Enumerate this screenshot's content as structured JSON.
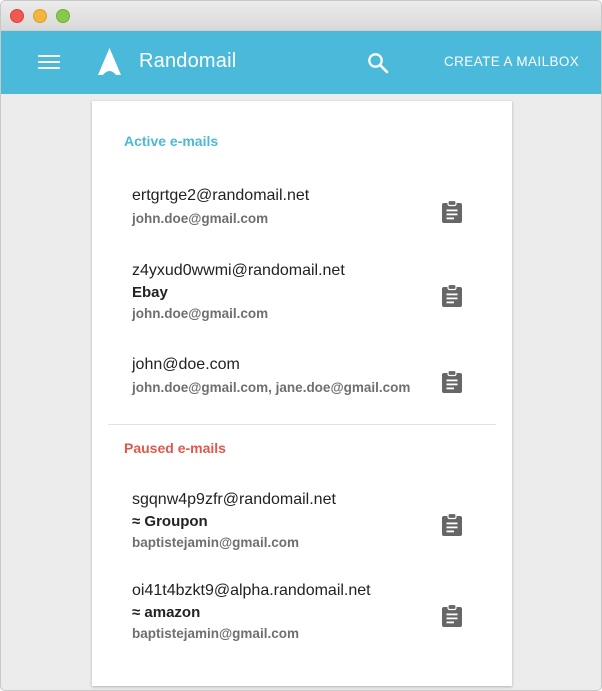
{
  "app": {
    "title": "Randomail",
    "create_label": "CREATE A MAILBOX",
    "brand_color": "#4bb9d9"
  },
  "active": {
    "heading": "Active e-mails",
    "color": "#4bb9d9",
    "items": [
      {
        "address": "ertgrtge2@randomail.net",
        "label": "",
        "forwards": "john.doe@gmail.com"
      },
      {
        "address": "z4yxud0wwmi@randomail.net",
        "label": "Ebay",
        "forwards": "john.doe@gmail.com"
      },
      {
        "address": "john@doe.com",
        "label": "",
        "forwards": "john.doe@gmail.com, jane.doe@gmail.com"
      }
    ]
  },
  "paused": {
    "heading": "Paused e-mails",
    "color": "#e2574c",
    "items": [
      {
        "address": "sgqnw4p9zfr@randomail.net",
        "label": "≈ Groupon",
        "forwards": "baptistejamin@gmail.com"
      },
      {
        "address": "oi41t4bzkt9@alpha.randomail.net",
        "label": "≈ amazon",
        "forwards": "baptistejamin@gmail.com"
      }
    ]
  },
  "icons": {
    "menu": "hamburger-menu-icon",
    "logo": "randomail-logo-icon",
    "search": "search-icon",
    "copy": "clipboard-icon"
  }
}
